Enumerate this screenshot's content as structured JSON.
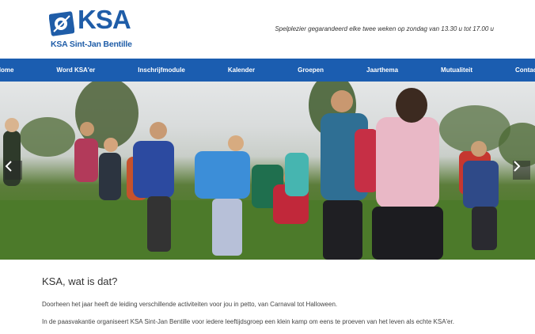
{
  "brand": {
    "logo_title": "KSA",
    "logo_subtitle": "KSA Sint-Jan Bentille",
    "tagline": "Spelplezier gegarandeerd elke twee weken op zondag van 13.30 u tot 17.00 u",
    "color": "#1f5da8"
  },
  "nav": {
    "items": [
      "Home",
      "Word KSA'er",
      "Inschrijfmodule",
      "Kalender",
      "Groepen",
      "Jaarthema",
      "Mutualiteit",
      "Contact"
    ],
    "background": "#1b5db0"
  },
  "slider": {
    "prev_icon": "chevron-left-icon",
    "next_icon": "chevron-right-icon"
  },
  "main": {
    "heading": "KSA, wat is dat?",
    "paragraphs": [
      "Doorheen het jaar heeft de leiding verschillende activiteiten voor jou in petto, van Carnaval tot Halloween.",
      "In de paasvakantie organiseert KSA Sint-Jan Bentille voor iedere leeftijdsgroep een klein kamp om eens te proeven van het leven als echte KSA'er."
    ]
  }
}
